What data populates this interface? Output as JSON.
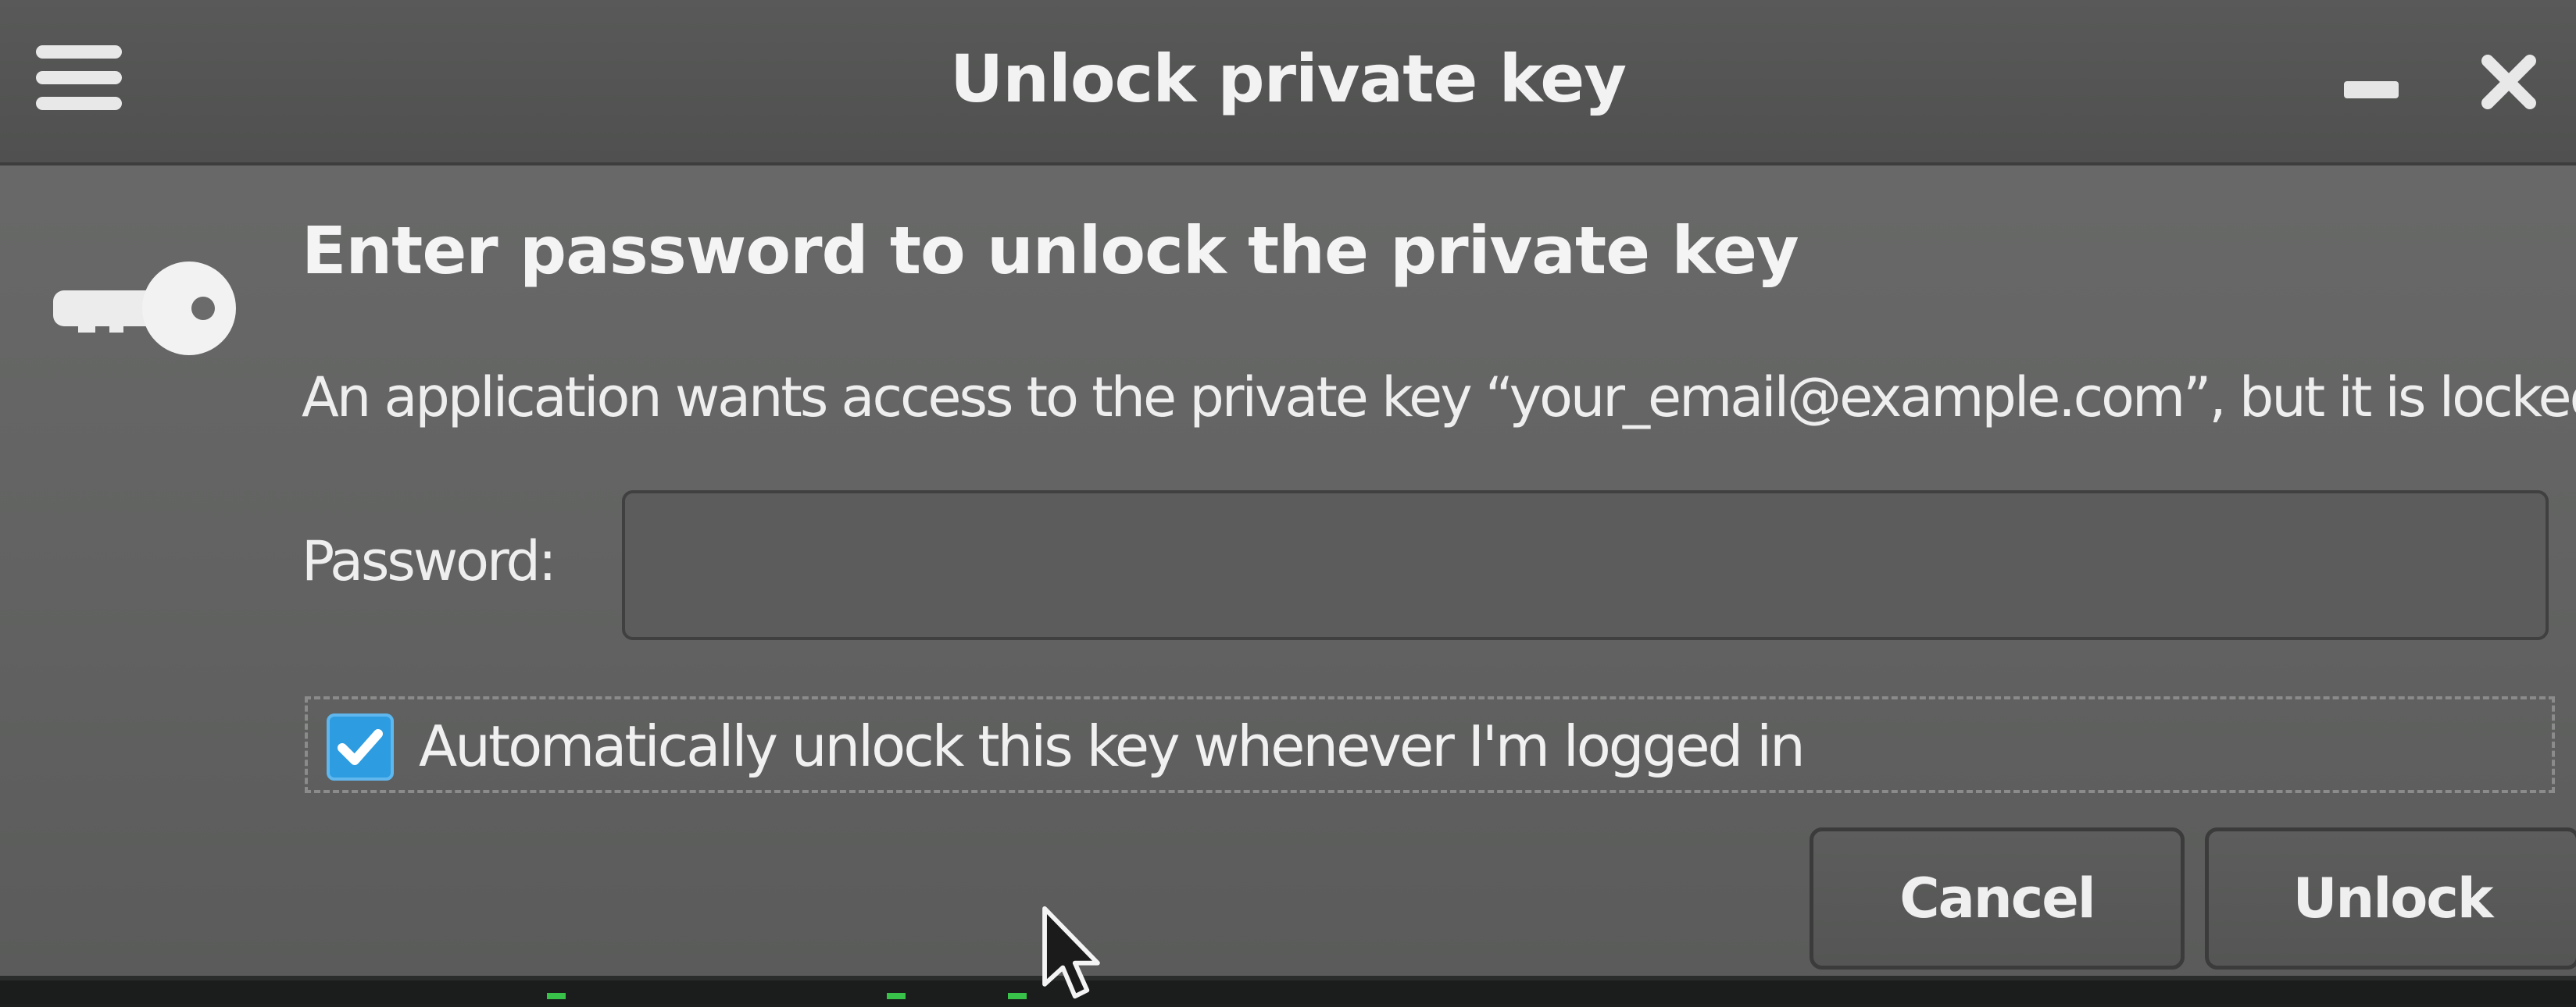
{
  "window": {
    "title": "Unlock private key"
  },
  "content": {
    "heading": "Enter password to unlock the private key",
    "message": "An application wants access to the private key “your_email@example.com”, but it is locked",
    "password_label": "Password:",
    "password_value": "",
    "auto_unlock": {
      "label": "Automatically unlock this key whenever I'm logged in",
      "checked": true
    }
  },
  "buttons": {
    "cancel": "Cancel",
    "unlock": "Unlock"
  },
  "icons": {
    "menu": "hamburger-menu-icon",
    "minimize": "minimize-icon",
    "close": "close-icon",
    "key": "key-icon",
    "checkmark": "checkmark-icon",
    "cursor": "mouse-pointer-icon"
  },
  "colors": {
    "checkbox_accent": "#2e9ce0",
    "dialog_bg": "#626362",
    "titlebar_bg": "#535453"
  }
}
